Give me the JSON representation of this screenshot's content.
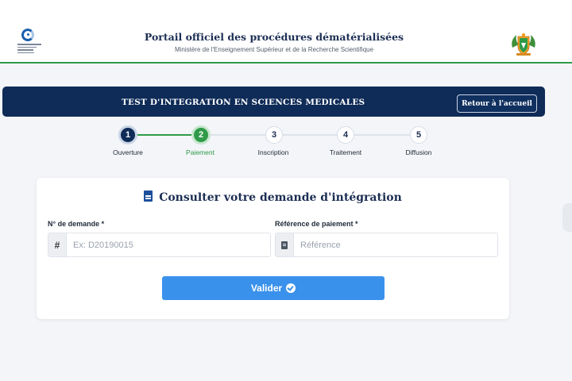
{
  "header": {
    "title": "Portail officiel des procédures dématérialisées",
    "subtitle": "Ministère de l'Enseignement Supérieur et de la Recherche Scientifique",
    "left_logo_icon": "ministry-logo-icon",
    "right_emblem_icon": "coat-of-arms-icon"
  },
  "banner": {
    "title": "TEST D'INTEGRATION EN SCIENCES MEDICALES",
    "home_button": "Retour à l'accueil"
  },
  "stepper": {
    "steps": [
      {
        "number": "1",
        "label": "Ouverture",
        "state": "done"
      },
      {
        "number": "2",
        "label": "Paiement",
        "state": "active"
      },
      {
        "number": "3",
        "label": "Inscription",
        "state": "todo"
      },
      {
        "number": "4",
        "label": "Traitement",
        "state": "todo"
      },
      {
        "number": "5",
        "label": "Diffusion",
        "state": "todo"
      }
    ]
  },
  "form": {
    "title": "Consulter votre demande d'intégration",
    "title_icon": "document-icon",
    "request_number": {
      "label": "N° de demande *",
      "addon": "#",
      "placeholder": "Ex: D20190015",
      "value": ""
    },
    "payment_ref": {
      "label": "Référence de paiement *",
      "addon_icon": "receipt-icon",
      "placeholder": "Référence",
      "value": ""
    },
    "submit_label": "Valider",
    "submit_icon": "check-circle-icon"
  },
  "colors": {
    "navy": "#0f2b57",
    "green": "#2f9a48",
    "blue_button": "#3a91ec"
  }
}
